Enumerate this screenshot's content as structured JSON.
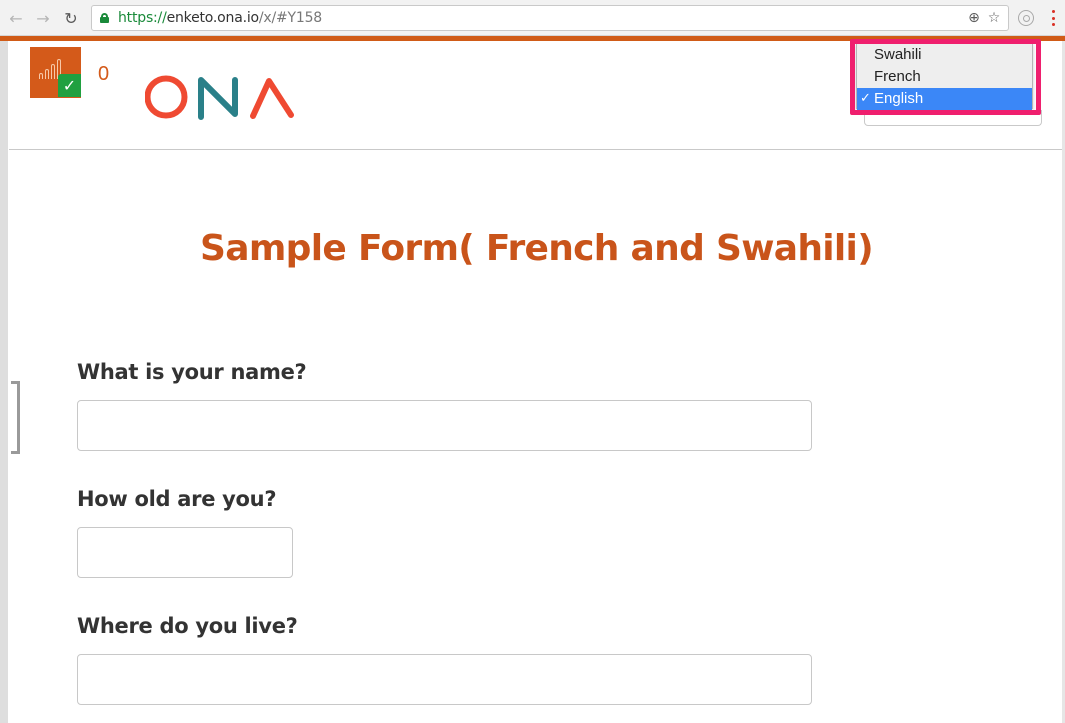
{
  "browser": {
    "url_scheme": "https://",
    "url_host": "enketo.ona.io",
    "url_path": "/x/#Y158",
    "icons": {
      "back": "arrow-left-icon",
      "forward": "arrow-right-icon",
      "reload": "reload-icon",
      "lock": "lock-icon",
      "zoom": "zoom-icon",
      "bookmark": "star-icon",
      "extension": "extension-icon",
      "menu": "kebab-menu-icon"
    }
  },
  "header": {
    "queue_count": "0",
    "status_icon": "signal-bars-check-icon",
    "logo_name": "ona-logo",
    "colors": {
      "accent": "#d05b17",
      "logo_red": "#ef4a32",
      "logo_teal": "#2a8089",
      "status_green": "#20a040"
    }
  },
  "language": {
    "options": [
      "Swahili",
      "French",
      "English"
    ],
    "selected": "English",
    "highlight_color": "#ef1f6e",
    "selected_color": "#3b87f7"
  },
  "form": {
    "title": "Sample Form( French and Swahili)",
    "title_color": "#c9541a",
    "questions": [
      {
        "label": "What is your name?",
        "value": ""
      },
      {
        "label": "How old are you?",
        "value": ""
      },
      {
        "label": "Where do you live?",
        "value": ""
      }
    ]
  }
}
